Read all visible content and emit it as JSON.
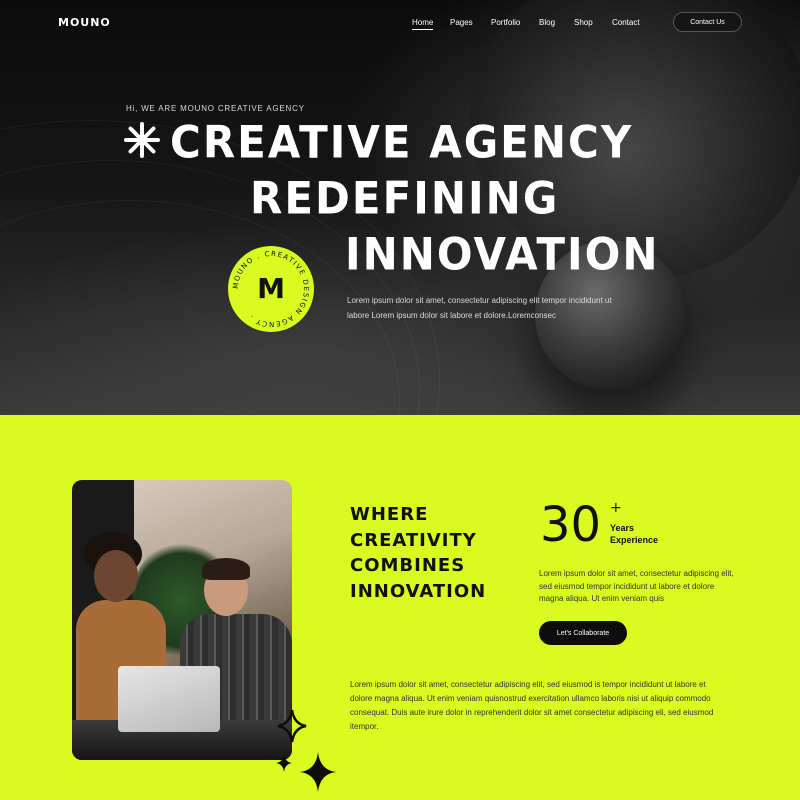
{
  "brand": {
    "logo_text": "MOUNO",
    "accent_color": "#d9fb1f",
    "dark_color": "#0d0d0d"
  },
  "nav": {
    "items": [
      {
        "label": "Home",
        "active": true
      },
      {
        "label": "Pages",
        "active": false
      },
      {
        "label": "Portfolio",
        "active": false
      },
      {
        "label": "Blog",
        "active": false
      },
      {
        "label": "Shop",
        "active": false
      },
      {
        "label": "Contact",
        "active": false
      }
    ],
    "cta_label": "Contact Us"
  },
  "hero": {
    "kicker": "Hi, WE ARE MOUNO CREATIVE AGENCY",
    "line1": "CREATIVE AGENCY",
    "line2": "REDEFINING",
    "line3": "INNOVATION",
    "badge_ring_text": "MOUNO . CREATIVE DESIGN AGENCY .",
    "badge_letter": "M",
    "description_line1": "Lorem ipsum dolor sit amet, consectetur adipiscing elit tempor incididunt ut",
    "description_line2": "labore Lorem ipsum dolor sit labore et dolore.Loremconsec",
    "decor_icon": "asterisk-icon"
  },
  "about": {
    "headline_lines": [
      "WHERE",
      "CREATIVITY",
      "COMBINES",
      "INNOVATION"
    ],
    "stat_number": "30",
    "stat_plus": "+",
    "stat_label_line1": "Years",
    "stat_label_line2": "Experience",
    "stat_description": "Lorem ipsum dolor sit amet, consectetur adipiscing elit, sed eiusmod tempor incididunt ut labore et dolore magna aliqua. Ut enim veniam quis",
    "cta_label": "Let's Collaborate",
    "body_text": "Lorem ipsum dolor sit amet, consectetur adipiscing elit, sed eiusmod is tempor incididunt ut labore et dolore magna aliqua. Ut enim veniam quisnostrud exercitation ullamco laboris nisi ut aliquip commodo consequat. Duis aute irure dolor in reprehenderit dolor sit amet consectetur adipiscing eli, sed eiusmod itempor.",
    "photo_icon": "team-photo",
    "decor_icon": "sparkle-icon"
  }
}
